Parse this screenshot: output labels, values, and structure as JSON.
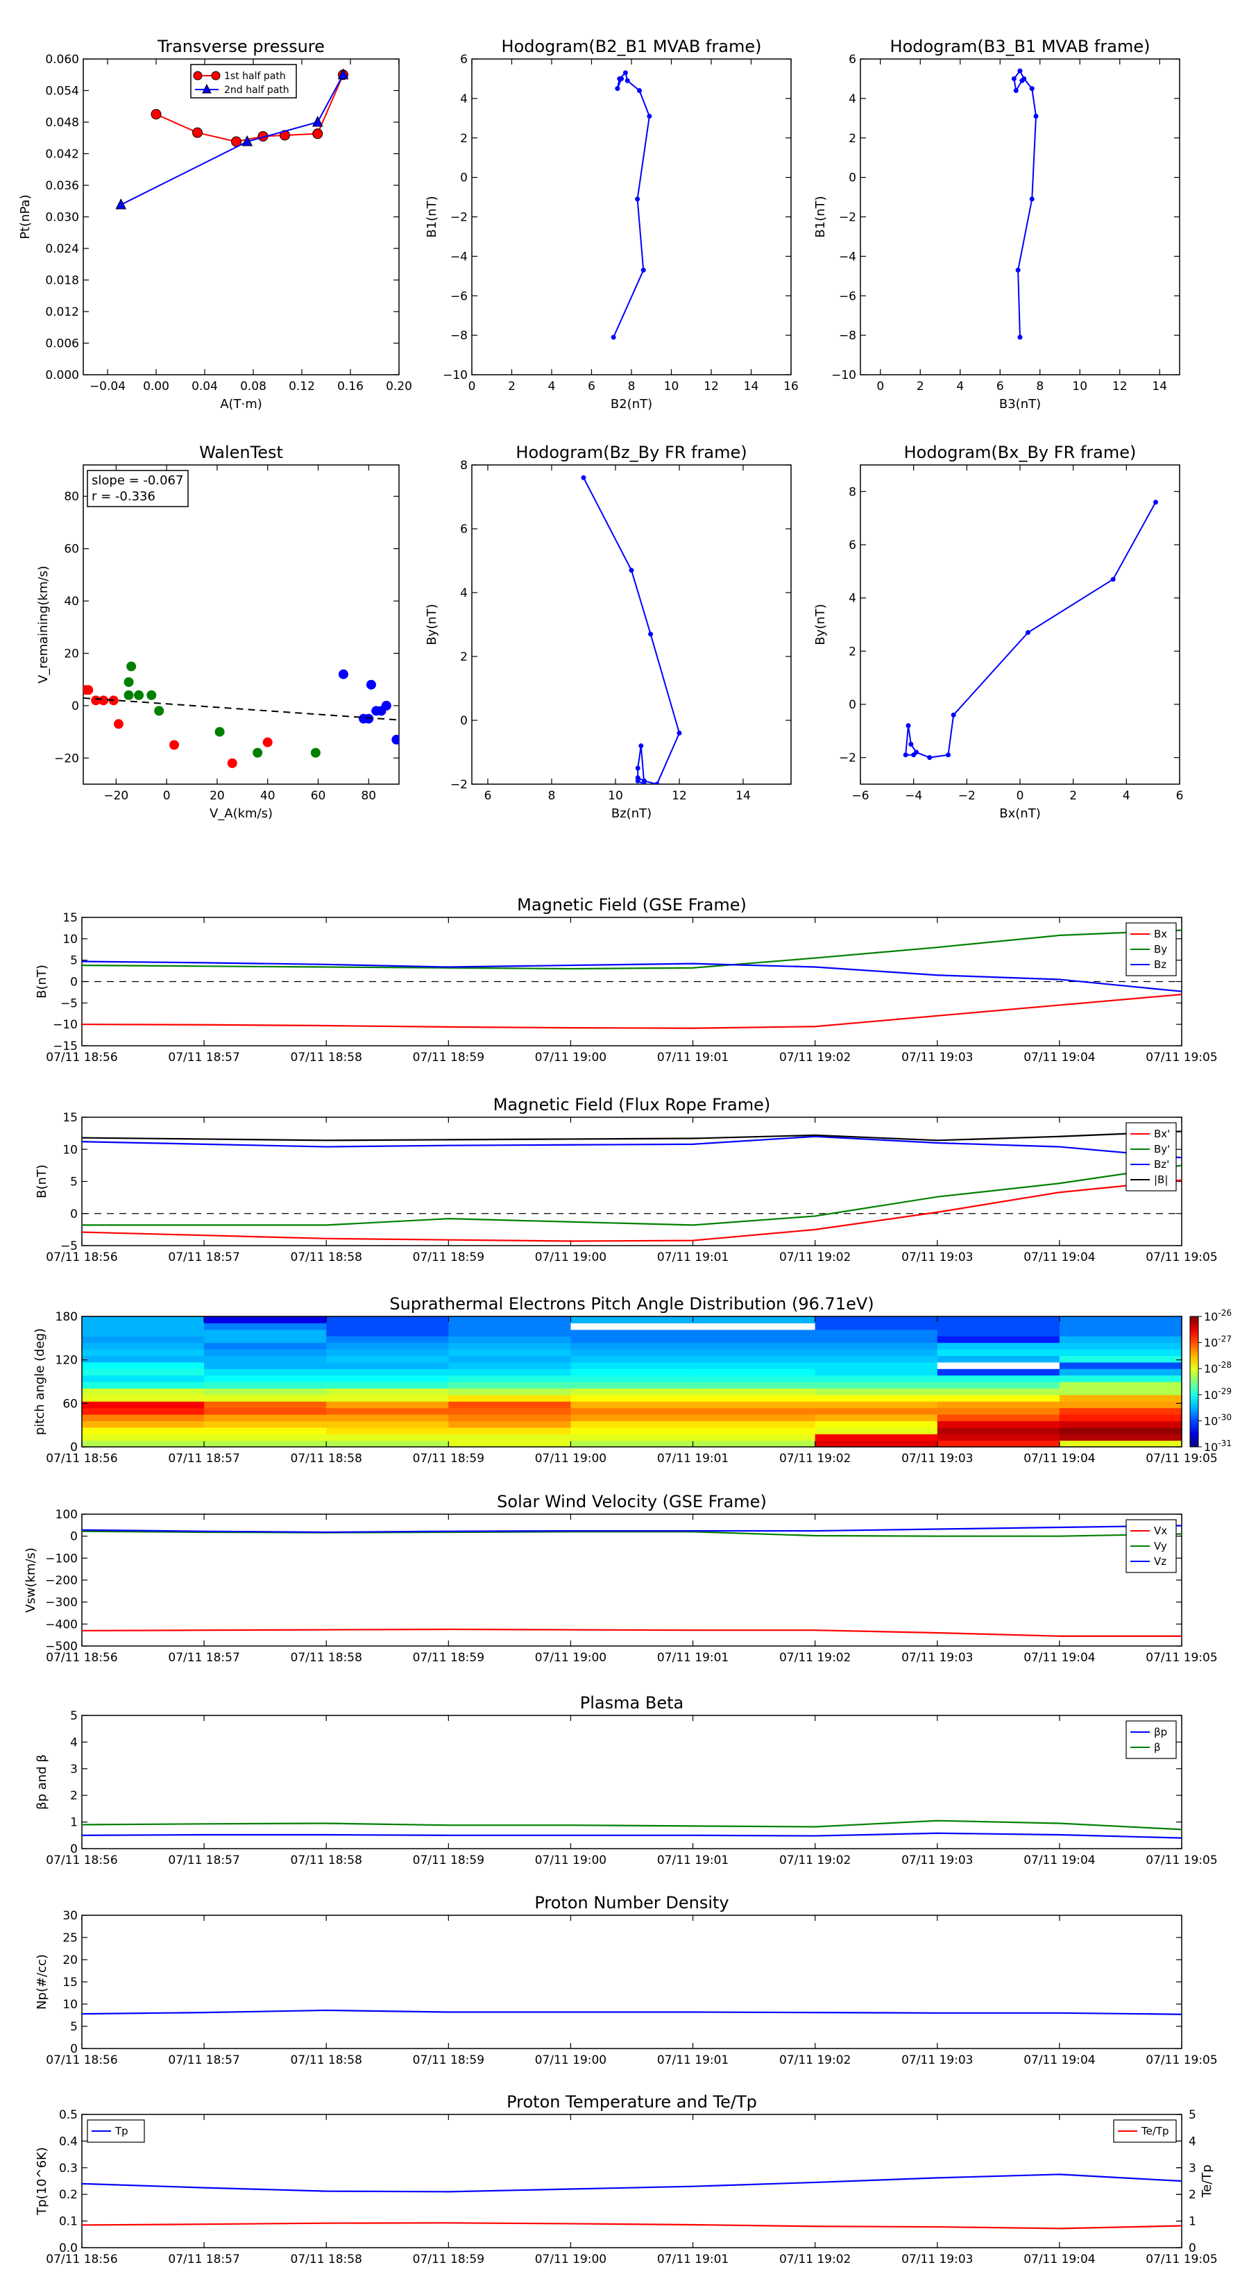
{
  "chart_data": [
    {
      "id": "pt",
      "type": "scatter",
      "title": "Transverse pressure",
      "xlabel": "A(T·m)",
      "ylabel": "Pt(nPa)",
      "xlim": [
        -0.06,
        0.2
      ],
      "ylim": [
        0,
        0.06
      ],
      "xticks": [
        -0.04,
        0.0,
        0.04,
        0.08,
        0.12,
        0.16,
        0.2
      ],
      "xticklabels": [
        "−0.04",
        "0.00",
        "0.04",
        "0.08",
        "0.12",
        "0.16",
        "0.20"
      ],
      "yticks": [
        0,
        0.006,
        0.012,
        0.018,
        0.024,
        0.03,
        0.036,
        0.042,
        0.048,
        0.054,
        0.06
      ],
      "yticklabels": [
        "0.000",
        "0.006",
        "0.012",
        "0.018",
        "0.024",
        "0.030",
        "0.036",
        "0.042",
        "0.048",
        "0.054",
        "0.060"
      ],
      "legend": {
        "position": "top-center",
        "entries": [
          "1st half path",
          "2nd half path"
        ]
      },
      "series": [
        {
          "name": "1st half path",
          "color": "#ff0000",
          "marker": "circle",
          "x": [
            0.0,
            0.034,
            0.066,
            0.088,
            0.106,
            0.133,
            0.154
          ],
          "y": [
            0.0495,
            0.046,
            0.0443,
            0.0453,
            0.0455,
            0.0458,
            0.057
          ]
        },
        {
          "name": "2nd half path",
          "color": "#0000ff",
          "marker": "triangle",
          "x": [
            -0.029,
            0.075,
            0.133,
            0.154
          ],
          "y": [
            0.0323,
            0.0443,
            0.048,
            0.057
          ]
        }
      ]
    },
    {
      "id": "h1",
      "type": "line",
      "title": "Hodogram(B2_B1 MVAB frame)",
      "xlabel": "B2(nT)",
      "ylabel": "B1(nT)",
      "xlim": [
        0,
        16
      ],
      "ylim": [
        -10,
        6
      ],
      "xticks": [
        0,
        2,
        4,
        6,
        8,
        10,
        12,
        14,
        16
      ],
      "yticks": [
        -10,
        -8,
        -6,
        -4,
        -2,
        0,
        2,
        4,
        6
      ],
      "series": [
        {
          "color": "#0000ff",
          "x": [
            7.1,
            8.6,
            8.3,
            8.9,
            8.4,
            7.8,
            7.7,
            7.4,
            7.3,
            7.5
          ],
          "y": [
            -8.1,
            -4.7,
            -1.1,
            3.1,
            4.4,
            4.9,
            5.3,
            5.0,
            4.5,
            5.0
          ]
        }
      ]
    },
    {
      "id": "h2",
      "type": "line",
      "title": "Hodogram(B3_B1 MVAB frame)",
      "xlabel": "B3(nT)",
      "ylabel": "B1(nT)",
      "xlim": [
        -1,
        15
      ],
      "ylim": [
        -10,
        6
      ],
      "xticks": [
        0,
        2,
        4,
        6,
        8,
        10,
        12,
        14
      ],
      "yticks": [
        -10,
        -8,
        -6,
        -4,
        -2,
        0,
        2,
        4,
        6
      ],
      "series": [
        {
          "color": "#0000ff",
          "x": [
            7.0,
            6.9,
            7.6,
            7.8,
            7.6,
            7.2,
            7.0,
            6.7,
            6.8,
            7.1
          ],
          "y": [
            -8.1,
            -4.7,
            -1.1,
            3.1,
            4.5,
            5.0,
            5.4,
            5.0,
            4.4,
            4.9
          ]
        }
      ]
    },
    {
      "id": "walen",
      "type": "scatter",
      "title": "WalenTest",
      "xlabel": "V_A(km/s)",
      "ylabel": "V_remaining(km/s)",
      "xlim": [
        -33,
        92
      ],
      "ylim": [
        -30,
        92
      ],
      "xticks": [
        -20,
        0,
        20,
        40,
        60,
        80
      ],
      "yticks": [
        -20,
        0,
        20,
        40,
        60,
        80
      ],
      "annotation": [
        "slope = -0.067",
        "r = -0.336"
      ],
      "fit": {
        "slope": -0.067,
        "intercept": 0.7
      },
      "series": [
        {
          "color": "#ff0000",
          "x": [
            -32,
            -31,
            -28,
            -25,
            -21,
            -19,
            3,
            26,
            40
          ],
          "y": [
            6,
            6,
            2,
            2,
            2,
            -7,
            -15,
            -22,
            -14
          ]
        },
        {
          "color": "#008000",
          "x": [
            -15,
            -15,
            -14,
            -11,
            -6,
            -3,
            21,
            36,
            59
          ],
          "y": [
            4,
            9,
            15,
            4,
            4,
            -2,
            -10,
            -18,
            -18
          ]
        },
        {
          "color": "#0000ff",
          "x": [
            70,
            78,
            80,
            81,
            83,
            85,
            87,
            91
          ],
          "y": [
            12,
            -5,
            -5,
            8,
            -2,
            -2,
            0,
            -13
          ]
        }
      ]
    },
    {
      "id": "h3",
      "type": "line",
      "title": "Hodogram(Bz_By FR frame)",
      "xlabel": "Bz(nT)",
      "ylabel": "By(nT)",
      "xlim": [
        5.5,
        15.5
      ],
      "ylim": [
        -2,
        8
      ],
      "xticks": [
        6,
        8,
        10,
        12,
        14
      ],
      "yticks": [
        -2,
        0,
        2,
        4,
        6,
        8
      ],
      "series": [
        {
          "color": "#0000ff",
          "x": [
            9.0,
            10.5,
            11.1,
            12.0,
            11.3,
            10.9,
            10.7,
            10.7,
            10.8,
            10.9,
            10.7
          ],
          "y": [
            7.6,
            4.7,
            2.7,
            -0.4,
            -2.0,
            -1.9,
            -1.8,
            -1.5,
            -0.8,
            -2.0,
            -1.9
          ]
        }
      ]
    },
    {
      "id": "h4",
      "type": "line",
      "title": "Hodogram(Bx_By FR frame)",
      "xlabel": "Bx(nT)",
      "ylabel": "By(nT)",
      "xlim": [
        -6,
        6
      ],
      "ylim": [
        -3,
        9
      ],
      "xticks": [
        -6,
        -4,
        -2,
        0,
        2,
        4,
        6
      ],
      "yticks": [
        -2,
        0,
        2,
        4,
        6,
        8
      ],
      "series": [
        {
          "color": "#0000ff",
          "x": [
            5.1,
            3.5,
            0.3,
            -2.5,
            -2.7,
            -3.4,
            -3.9,
            -4.1,
            -4.2,
            -4.3,
            -4.0
          ],
          "y": [
            7.6,
            4.7,
            2.7,
            -0.4,
            -1.9,
            -2.0,
            -1.8,
            -1.5,
            -0.8,
            -1.9,
            -1.9
          ]
        }
      ]
    },
    {
      "id": "bgse",
      "type": "line",
      "title": "Magnetic Field (GSE Frame)",
      "ylabel": "B(nT)",
      "ylim": [
        -15,
        15
      ],
      "yticks": [
        -15,
        -10,
        -5,
        0,
        5,
        10,
        15
      ],
      "zero_line": true,
      "legend": {
        "position": "top-right",
        "entries": [
          "Bx",
          "By",
          "Bz"
        ]
      },
      "series": [
        {
          "name": "Bx",
          "color": "#ff0000",
          "values": [
            -10.0,
            -10.1,
            -10.3,
            -10.6,
            -10.8,
            -10.9,
            -10.5,
            -8.0,
            -5.5,
            -3.0
          ]
        },
        {
          "name": "By",
          "color": "#008000",
          "values": [
            3.8,
            3.6,
            3.4,
            3.2,
            3.0,
            3.2,
            5.5,
            8.0,
            10.8,
            12.0
          ]
        },
        {
          "name": "Bz",
          "color": "#0000ff",
          "values": [
            4.7,
            4.4,
            4.0,
            3.4,
            3.8,
            4.2,
            3.4,
            1.5,
            0.5,
            -2.3
          ]
        }
      ]
    },
    {
      "id": "bfr",
      "type": "line",
      "title": "Magnetic Field (Flux Rope Frame)",
      "ylabel": "B(nT)",
      "ylim": [
        -5,
        15
      ],
      "yticks": [
        -5,
        0,
        5,
        10,
        15
      ],
      "zero_line": true,
      "legend": {
        "position": "top-right",
        "entries": [
          "Bx'",
          "By'",
          "Bz'",
          "|B|"
        ]
      },
      "series": [
        {
          "name": "Bx'",
          "color": "#ff0000",
          "values": [
            -2.9,
            -3.4,
            -3.9,
            -4.1,
            -4.3,
            -4.2,
            -2.5,
            0.2,
            3.3,
            5.2
          ]
        },
        {
          "name": "By'",
          "color": "#008000",
          "values": [
            -1.8,
            -1.8,
            -1.8,
            -0.8,
            -1.3,
            -1.8,
            -0.4,
            2.6,
            4.7,
            7.5
          ]
        },
        {
          "name": "Bz'",
          "color": "#0000ff",
          "values": [
            11.2,
            10.8,
            10.4,
            10.6,
            10.7,
            10.8,
            12.0,
            11.0,
            10.4,
            8.7
          ]
        },
        {
          "name": "|B|",
          "color": "#000000",
          "values": [
            11.8,
            11.6,
            11.4,
            11.5,
            11.6,
            11.7,
            12.2,
            11.4,
            12.0,
            12.8
          ]
        }
      ]
    },
    {
      "id": "pad",
      "type": "heatmap",
      "title": "Suprathermal Electrons Pitch Angle Distribution (96.71eV)",
      "ylabel": "pitch angle (deg)",
      "ylim": [
        0,
        180
      ],
      "yticks": [
        0,
        60,
        120,
        180
      ],
      "colorbar": {
        "ticks": [
          "-26",
          "-27",
          "-28",
          "-29",
          "-30",
          "-31"
        ]
      },
      "rows_bottom_to_top": 20,
      "columns": [
        [
          0.55,
          0.6,
          0.62,
          0.7,
          0.75,
          0.85,
          0.88,
          0.6,
          0.58,
          0.4,
          0.35,
          0.4,
          0.38,
          0.3,
          0.32,
          0.3,
          0.28,
          0.3,
          0.3,
          0.3
        ],
        [
          0.55,
          0.6,
          0.62,
          0.68,
          0.72,
          0.8,
          0.78,
          0.6,
          0.55,
          0.42,
          0.38,
          0.35,
          0.3,
          0.3,
          0.28,
          0.25,
          0.3,
          0.3,
          0.25,
          0.1
        ],
        [
          0.55,
          0.6,
          0.65,
          0.68,
          0.72,
          0.78,
          0.72,
          0.6,
          0.58,
          0.42,
          0.38,
          0.35,
          0.3,
          0.32,
          0.3,
          0.28,
          0.25,
          0.2,
          0.2,
          0.2
        ],
        [
          0.6,
          0.6,
          0.65,
          0.72,
          0.75,
          0.78,
          0.8,
          0.65,
          0.55,
          0.45,
          0.4,
          0.35,
          0.32,
          0.3,
          0.32,
          0.3,
          0.28,
          0.25,
          0.25,
          0.25
        ],
        [
          0.55,
          0.6,
          0.62,
          0.65,
          0.72,
          0.75,
          0.7,
          0.62,
          0.58,
          0.45,
          0.4,
          0.38,
          0.35,
          0.32,
          0.3,
          0.28,
          0.25,
          0.25,
          -1,
          0.3
        ],
        [
          0.55,
          0.6,
          0.62,
          0.65,
          0.72,
          0.75,
          0.7,
          0.62,
          0.58,
          0.45,
          0.4,
          0.38,
          0.35,
          0.32,
          0.3,
          0.28,
          0.25,
          0.25,
          -1,
          0.3
        ],
        [
          0.9,
          0.88,
          0.6,
          0.62,
          0.7,
          0.75,
          0.7,
          0.62,
          0.55,
          0.45,
          0.4,
          0.35,
          0.35,
          0.32,
          0.3,
          0.28,
          0.25,
          0.25,
          0.2,
          0.2
        ],
        [
          0.85,
          0.92,
          0.95,
          0.9,
          0.8,
          0.75,
          0.72,
          0.62,
          0.55,
          0.45,
          0.4,
          0.18,
          -1,
          0.3,
          0.35,
          0.32,
          0.15,
          0.2,
          0.2,
          0.2
        ],
        [
          0.6,
          0.95,
          0.98,
          0.92,
          0.85,
          0.82,
          0.72,
          0.7,
          0.55,
          0.55,
          0.4,
          0.3,
          0.2,
          0.4,
          0.35,
          0.32,
          0.3,
          0.25,
          0.25,
          0.25
        ]
      ]
    },
    {
      "id": "vsw",
      "type": "line",
      "title": "Solar Wind Velocity (GSE Frame)",
      "ylabel": "Vsw(km/s)",
      "ylim": [
        -500,
        100
      ],
      "yticks": [
        -500,
        -400,
        -300,
        -200,
        -100,
        0,
        100
      ],
      "legend": {
        "position": "top-right",
        "entries": [
          "Vx",
          "Vy",
          "Vz"
        ]
      },
      "series": [
        {
          "name": "Vx",
          "color": "#ff0000",
          "values": [
            -430,
            -428,
            -426,
            -424,
            -426,
            -428,
            -428,
            -440,
            -455,
            -455
          ]
        },
        {
          "name": "Vy",
          "color": "#008000",
          "values": [
            22,
            18,
            16,
            18,
            20,
            20,
            2,
            0,
            0,
            10
          ]
        },
        {
          "name": "Vz",
          "color": "#0000ff",
          "values": [
            28,
            22,
            18,
            22,
            24,
            24,
            24,
            32,
            40,
            48
          ]
        }
      ]
    },
    {
      "id": "beta",
      "type": "line",
      "title": "Plasma Beta",
      "ylabel": "βp and β",
      "ylim": [
        0,
        5
      ],
      "yticks": [
        0,
        1,
        2,
        3,
        4,
        5
      ],
      "legend": {
        "position": "top-right",
        "entries": [
          "βp",
          "β"
        ]
      },
      "series": [
        {
          "name": "βp",
          "color": "#0000ff",
          "values": [
            0.5,
            0.52,
            0.52,
            0.5,
            0.5,
            0.5,
            0.48,
            0.58,
            0.52,
            0.4
          ]
        },
        {
          "name": "β",
          "color": "#008000",
          "values": [
            0.9,
            0.93,
            0.95,
            0.88,
            0.88,
            0.85,
            0.82,
            1.05,
            0.95,
            0.72
          ]
        }
      ]
    },
    {
      "id": "np",
      "type": "line",
      "title": "Proton Number Density",
      "ylabel": "Np(#/cc)",
      "ylim": [
        0,
        30
      ],
      "yticks": [
        0,
        5,
        10,
        15,
        20,
        25,
        30
      ],
      "series": [
        {
          "color": "#0000ff",
          "values": [
            7.8,
            8.1,
            8.6,
            8.2,
            8.2,
            8.2,
            8.1,
            8.0,
            8.0,
            7.7
          ]
        }
      ]
    },
    {
      "id": "tp",
      "type": "line",
      "title": "Proton Temperature and Te/Tp",
      "ylabel": "Tp(10^6K)",
      "ylabel_right": "Te/Tp",
      "ylim": [
        0,
        0.5
      ],
      "yticks": [
        0,
        0.1,
        0.2,
        0.3,
        0.4,
        0.5
      ],
      "yticklabels": [
        "0.0",
        "0.1",
        "0.2",
        "0.3",
        "0.4",
        "0.5"
      ],
      "ylim_right": [
        0,
        5
      ],
      "yticks_right": [
        0,
        1,
        2,
        3,
        4,
        5
      ],
      "legend": {
        "entries": [
          "Tp",
          "Te/Tp"
        ]
      },
      "series": [
        {
          "name": "Tp",
          "color": "#0000ff",
          "axis": "left",
          "values": [
            0.24,
            0.225,
            0.212,
            0.21,
            0.22,
            0.23,
            0.245,
            0.262,
            0.275,
            0.25
          ]
        },
        {
          "name": "Te/Tp",
          "color": "#ff0000",
          "axis": "right",
          "values": [
            0.85,
            0.88,
            0.92,
            0.93,
            0.9,
            0.86,
            0.8,
            0.78,
            0.72,
            0.82
          ]
        }
      ]
    }
  ],
  "time_axis": {
    "tick_labels": [
      "07/11 18:56",
      "07/11 18:57",
      "07/11 18:58",
      "07/11 18:59",
      "07/11 19:00",
      "07/11 19:01",
      "07/11 19:02",
      "07/11 19:03",
      "07/11 19:04",
      "07/11 19:05"
    ]
  }
}
